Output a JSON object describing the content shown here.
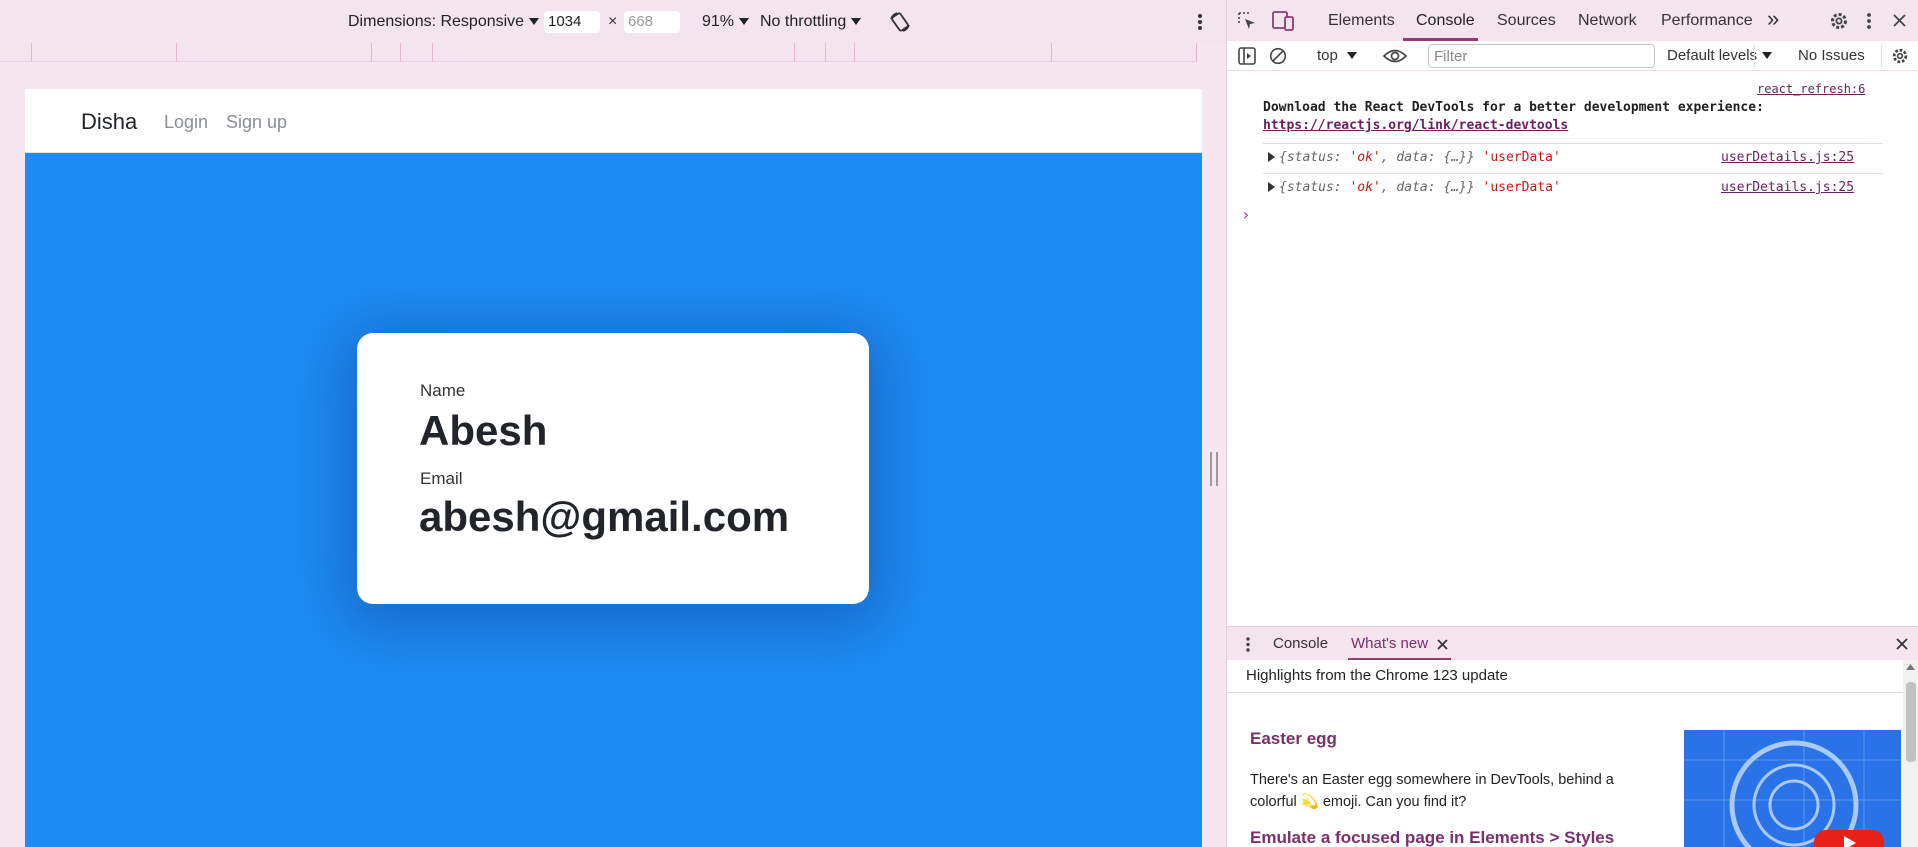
{
  "device_toolbar": {
    "dimensions_label": "Dimensions: Responsive",
    "width_value": "1034",
    "height_placeholder": "668",
    "times_sign": "×",
    "zoom": "91%",
    "throttling": "No throttling",
    "rotate_icon": "rotate-icon",
    "more_icon": "vertical-ellipsis-icon"
  },
  "emulated_page": {
    "navbar": {
      "brand": "Disha",
      "links": [
        "Login",
        "Sign up"
      ]
    },
    "profile_card": {
      "name_label": "Name",
      "name_value": "Abesh",
      "email_label": "Email",
      "email_value": "abesh@gmail.com"
    },
    "background_color": "#1e8cf5"
  },
  "devtools": {
    "tabs": [
      "Elements",
      "Console",
      "Sources",
      "Network",
      "Performance"
    ],
    "active_tab": "Console",
    "overflow_label": "»",
    "console_toolbar": {
      "context": "top",
      "filter_placeholder": "Filter",
      "levels": "Default levels",
      "issues": "No Issues"
    },
    "messages": {
      "banner_source": "react_refresh:6",
      "banner_text": "Download the React DevTools for a better development experience: ",
      "banner_link": "https://reactjs.org/link/react-devtools",
      "logs": [
        {
          "prefix": "{status: ",
          "status": "'ok'",
          "middle": ", data: {…}} ",
          "label": "'userData'",
          "source": "userDetails.js:25"
        },
        {
          "prefix": "{status: ",
          "status": "'ok'",
          "middle": ", data: {…}} ",
          "label": "'userData'",
          "source": "userDetails.js:25"
        }
      ],
      "prompt": "›"
    },
    "drawer": {
      "tabs": [
        "Console",
        "What's new"
      ],
      "active_tab": "What's new",
      "highlights": "Highlights from the Chrome 123 update",
      "sections": [
        {
          "title": "Easter egg",
          "text": "There's an Easter egg somewhere in DevTools, behind a colorful 💫 emoji. Can you find it?"
        },
        {
          "title": "Emulate a focused page in Elements > Styles"
        }
      ]
    },
    "accent_color": "#8e3b78"
  }
}
